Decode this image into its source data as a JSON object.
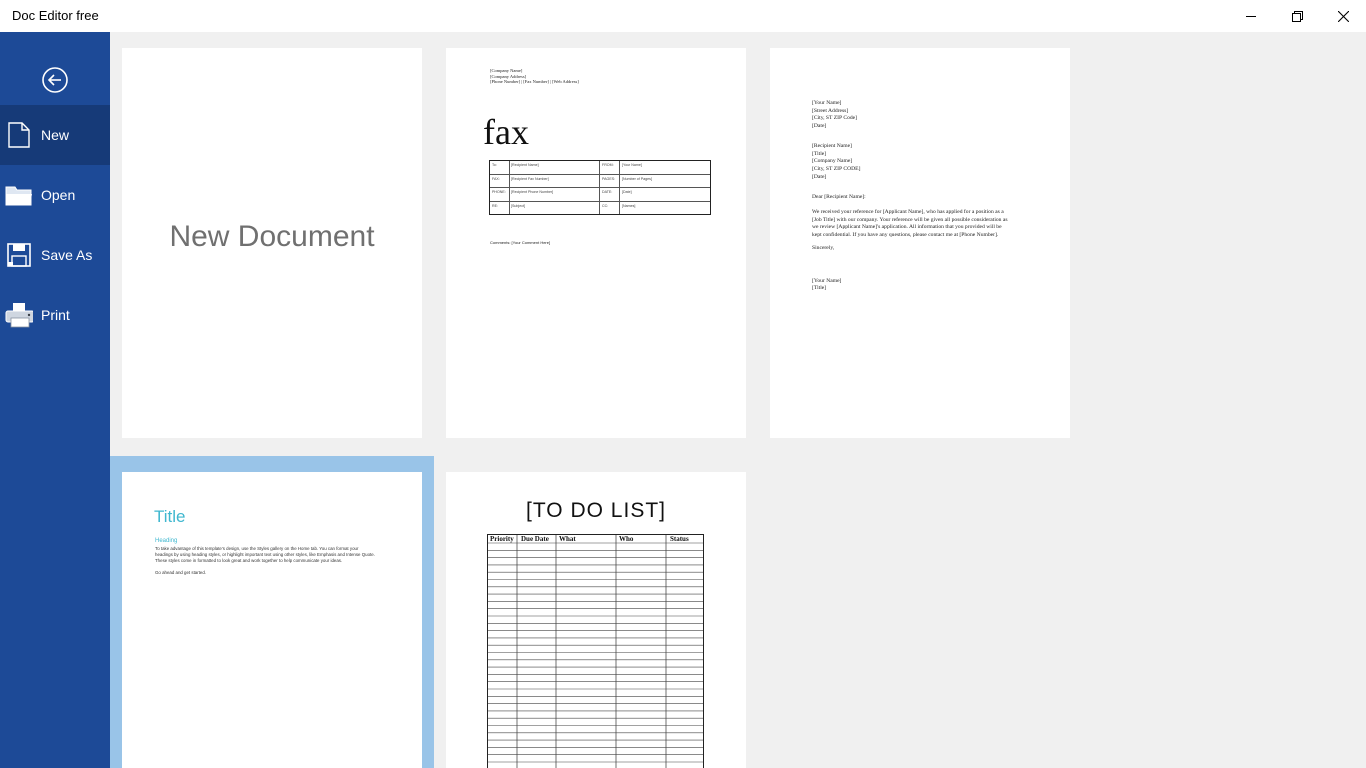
{
  "window": {
    "title": "Doc Editor free",
    "minimize_icon": "minimize-icon",
    "maximize_icon": "restore-icon",
    "close_icon": "close-icon"
  },
  "sidebar": {
    "back_icon": "back-arrow-icon",
    "items": [
      {
        "label": "New",
        "icon": "new-document-icon",
        "active": true
      },
      {
        "label": "Open",
        "icon": "folder-icon",
        "active": false
      },
      {
        "label": "Save As",
        "icon": "save-icon",
        "active": false
      },
      {
        "label": "Print",
        "icon": "printer-icon",
        "active": false
      }
    ]
  },
  "templates": {
    "blank": {
      "label": "New Document"
    },
    "fax": {
      "header_lines": [
        "[Company Name]",
        "[Company Address]",
        "[Phone Number] | [Fax Number] | [Web Address]"
      ],
      "heading": "fax",
      "rows": [
        [
          "To:",
          "[Recipient Name]",
          "FROM:",
          "[Your Name]"
        ],
        [
          "FAX:",
          "[Recipient Fax Number]",
          "PAGES:",
          "[Number of Pages]"
        ],
        [
          "PHONE:",
          "[Recipient Phone Number]",
          "DATE:",
          "[Date]"
        ],
        [
          "RE:",
          "[Subject]",
          "CC:",
          "[Names]"
        ]
      ],
      "comments": "Comments: [Your Comment Here]"
    },
    "letter": {
      "sender": [
        "[Your Name]",
        "[Street Address]",
        "[City, ST ZIP Code]",
        "[Date]"
      ],
      "recipient": [
        "[Recipient Name]",
        "[Title]",
        "[Company Name]",
        "[City, ST ZIP CODE]",
        "[Date]"
      ],
      "salutation": "Dear [Recipient Name]:",
      "body": [
        "We received your reference for [Applicant Name], who has applied for a position as a",
        "[Job Title] with our company.  Your reference will be given all possible consideration as",
        "we review [Applicant Name]'s application.  All information that you provided will be",
        "kept confidential.  If you have any questions, please contact me at [Phone Number]."
      ],
      "closing": "Sincerely,",
      "signature": [
        "[Your Name]",
        "[Title]"
      ]
    },
    "report": {
      "title": "Title",
      "heading": "Heading",
      "body": [
        "To take advantage of this template's design, use the Styles gallery on the Home tab. You can format your",
        "headings by using heading styles, or highlight important text using other styles, like Emphasis and Intense Quote.",
        "These styles come in formatted to look great and work together to help communicate your ideas."
      ],
      "closing": "Go ahead and get started."
    },
    "todo": {
      "title": "[TO DO LIST]",
      "columns": [
        "Priority",
        "Due Date",
        "What",
        "Who",
        "Status"
      ]
    }
  },
  "colors": {
    "sidebar": "#1d4a97",
    "sidebar_active": "#163a78",
    "selection": "#99c4e8",
    "accent_title": "#3fb7cf",
    "background": "#f0f0f0"
  }
}
